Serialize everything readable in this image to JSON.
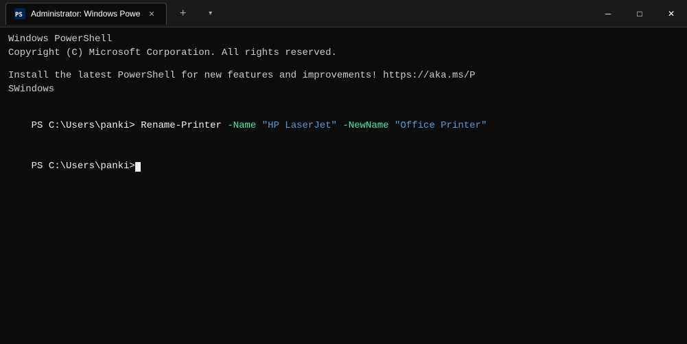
{
  "titlebar": {
    "tab_title": "Administrator: Windows Powe",
    "new_tab_label": "+",
    "dropdown_label": "▾",
    "minimize_label": "─",
    "maximize_label": "□",
    "close_label": "✕"
  },
  "terminal": {
    "line1": "Windows PowerShell",
    "line2": "Copyright (C) Microsoft Corporation. All rights reserved.",
    "line3_prefix": "Install ",
    "line3_the": "the",
    "line3_mid": " latest PowerShell for new ",
    "line3_features": "features",
    "line3_suffix": " and improvements! https://aka.ms/P",
    "line4": "SWindows",
    "prompt1": "PS C:\\Users\\panki>",
    "cmd1_name": "Rename-Printer",
    "cmd1_param1": " -Name ",
    "cmd1_str1": "\"HP LaserJet\"",
    "cmd1_param2": " -NewName ",
    "cmd1_str2": "\"Office Printer\"",
    "prompt2": "PS C:\\Users\\panki>"
  },
  "icon": {
    "powershell_color": "#012456"
  }
}
